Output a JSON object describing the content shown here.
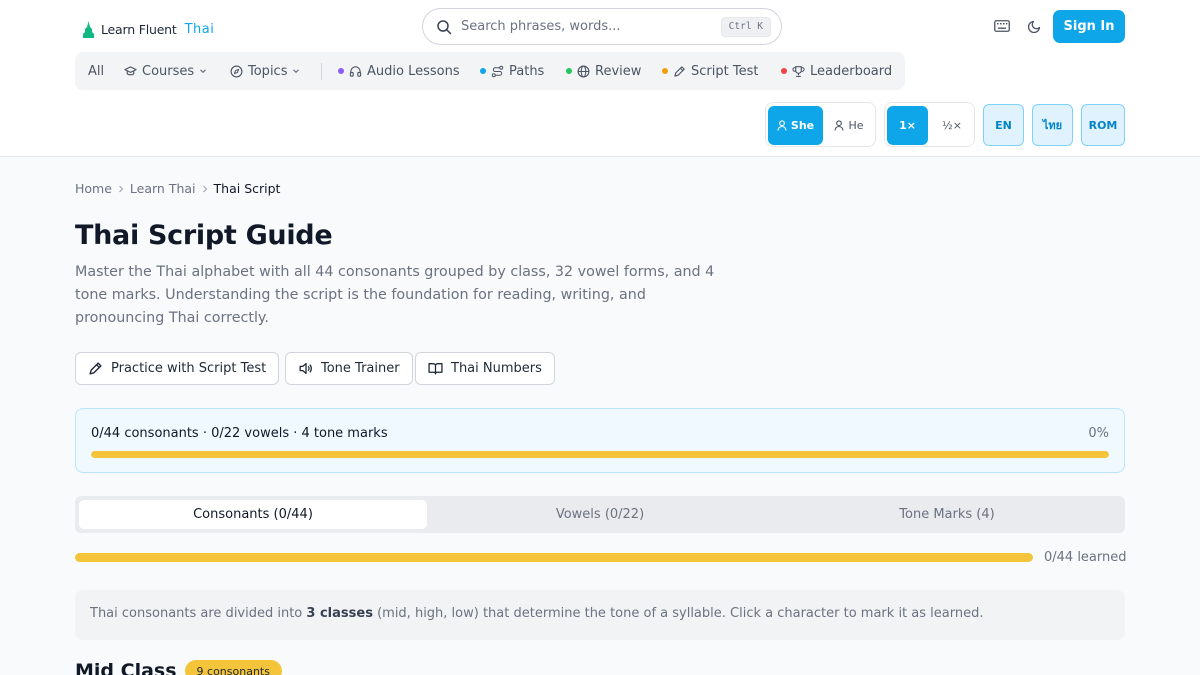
{
  "brand": {
    "name": "Learn Fluent",
    "accent": "Thai"
  },
  "search": {
    "placeholder": "Search phrases, words...",
    "shortcut": "Ctrl K"
  },
  "header_actions": {
    "keyboard_icon": "keyboard-icon",
    "theme_icon": "moon-icon",
    "signin_label": "Sign In"
  },
  "nav": [
    {
      "label": "All"
    },
    {
      "label": "Courses",
      "icon": "graduation-cap-icon",
      "dropdown": true
    },
    {
      "label": "Topics",
      "icon": "compass-icon",
      "dropdown": true
    },
    {
      "label": "Audio Lessons",
      "icon": "headphones-icon",
      "dot": "#8b5cf6"
    },
    {
      "label": "Paths",
      "icon": "route-icon",
      "dot": "#0ea5e9"
    },
    {
      "label": "Review",
      "icon": "globe-icon",
      "dot": "#22c55e"
    },
    {
      "label": "Script Test",
      "icon": "pen-icon",
      "dot": "#f59e0b"
    },
    {
      "label": "Leaderboard",
      "icon": "trophy-icon",
      "dot": "#ef4444"
    }
  ],
  "voice": {
    "she": "She",
    "he": "He",
    "selected": "She"
  },
  "speed": {
    "normal": "1×",
    "half": "½×",
    "selected": "1×"
  },
  "lang": {
    "en": "EN",
    "thai": "ไทย",
    "rom": "ROM"
  },
  "breadcrumb": {
    "home": "Home",
    "learn": "Learn Thai",
    "current": "Thai Script"
  },
  "page": {
    "title": "Thai Script Guide",
    "lead": "Master the Thai alphabet with all 44 consonants grouped by class, 32 vowel forms, and 4 tone marks. Understanding the script is the foundation for reading, writing, and pronouncing Thai correctly."
  },
  "actions": {
    "script_test": "Practice with Script Test",
    "tone_trainer": "Tone Trainer",
    "thai_numbers": "Thai Numbers"
  },
  "progress": {
    "summary": "0/44 consonants · 0/22 vowels · 4 tone marks",
    "percent_label": "0%",
    "percent": 0
  },
  "tabs": [
    {
      "label": "Consonants (0/44)",
      "active": true
    },
    {
      "label": "Vowels (0/22)",
      "active": false
    },
    {
      "label": "Tone Marks (4)",
      "active": false
    }
  ],
  "learned": {
    "label": "0/44 learned",
    "fraction": 0
  },
  "info": {
    "before": "Thai consonants are divided into ",
    "bold": "3 classes",
    "after": " (mid, high, low) that determine the tone of a syllable. Click a character to mark it as learned."
  },
  "section": {
    "title": "Mid Class",
    "badge": "9 consonants"
  },
  "colors": {
    "accent": "#0ea5e9",
    "progress": "#f4c43a"
  }
}
